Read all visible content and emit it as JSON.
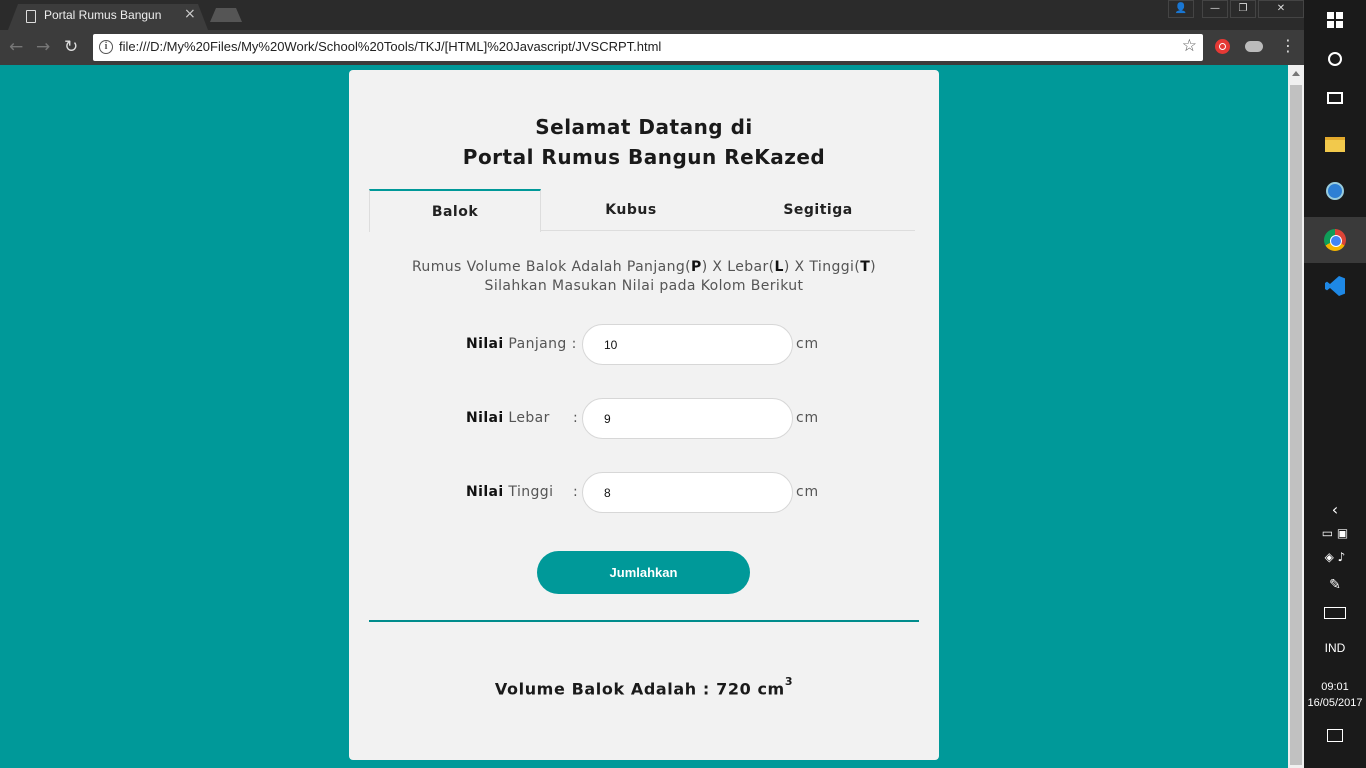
{
  "browser": {
    "tab_title": "Portal Rumus Bangun",
    "tab_close": "×",
    "url": "file:///D:/My%20Files/My%20Work/School%20Tools/TKJ/[HTML]%20Javascript/JVSCRPT.html",
    "window_controls": {
      "minimize": "—",
      "maximize": "❐",
      "close": "✕",
      "user": "👤"
    }
  },
  "page": {
    "title_line1": "Selamat Datang di",
    "title_line2": "Portal Rumus Bangun ReKazed",
    "tabs": [
      "Balok",
      "Kubus",
      "Segitiga"
    ],
    "active_tab": "Balok",
    "desc": {
      "prefix": "Rumus Volume Balok Adalah Panjang(",
      "p": "P",
      "mid1": ") X Lebar(",
      "l": "L",
      "mid2": ") X Tinggi(",
      "t": "T",
      "suffix": ")",
      "line2": "Silahkan Masukan Nilai pada Kolom Berikut"
    },
    "fields": [
      {
        "label_bold": "Nilai",
        "label_rest": "Panjang :",
        "colon": "",
        "value": "10",
        "unit": "cm"
      },
      {
        "label_bold": "Nilai",
        "label_rest": "Lebar",
        "colon": ":",
        "value": "9",
        "unit": "cm"
      },
      {
        "label_bold": "Nilai",
        "label_rest": "Tinggi",
        "colon": ":",
        "value": "8",
        "unit": "cm"
      }
    ],
    "submit_label": "Jumlahkan",
    "result_text": "Volume Balok Adalah : 720 cm",
    "result_sup": "3"
  },
  "taskbar": {
    "language": "IND",
    "time": "09:01",
    "date": "16/05/2017"
  },
  "colors": {
    "page_bg": "#009999",
    "card_bg": "#f2f2f2",
    "accent": "#009999"
  },
  "icons": [
    "page-icon",
    "back-arrow-icon",
    "forward-arrow-icon",
    "reload-icon",
    "info-icon",
    "star-icon",
    "menu-dots-icon",
    "windows-start-icon",
    "cortana-icon",
    "task-view-icon",
    "file-explorer-icon",
    "globe-icon",
    "chrome-icon",
    "vscode-icon",
    "notification-icon"
  ]
}
